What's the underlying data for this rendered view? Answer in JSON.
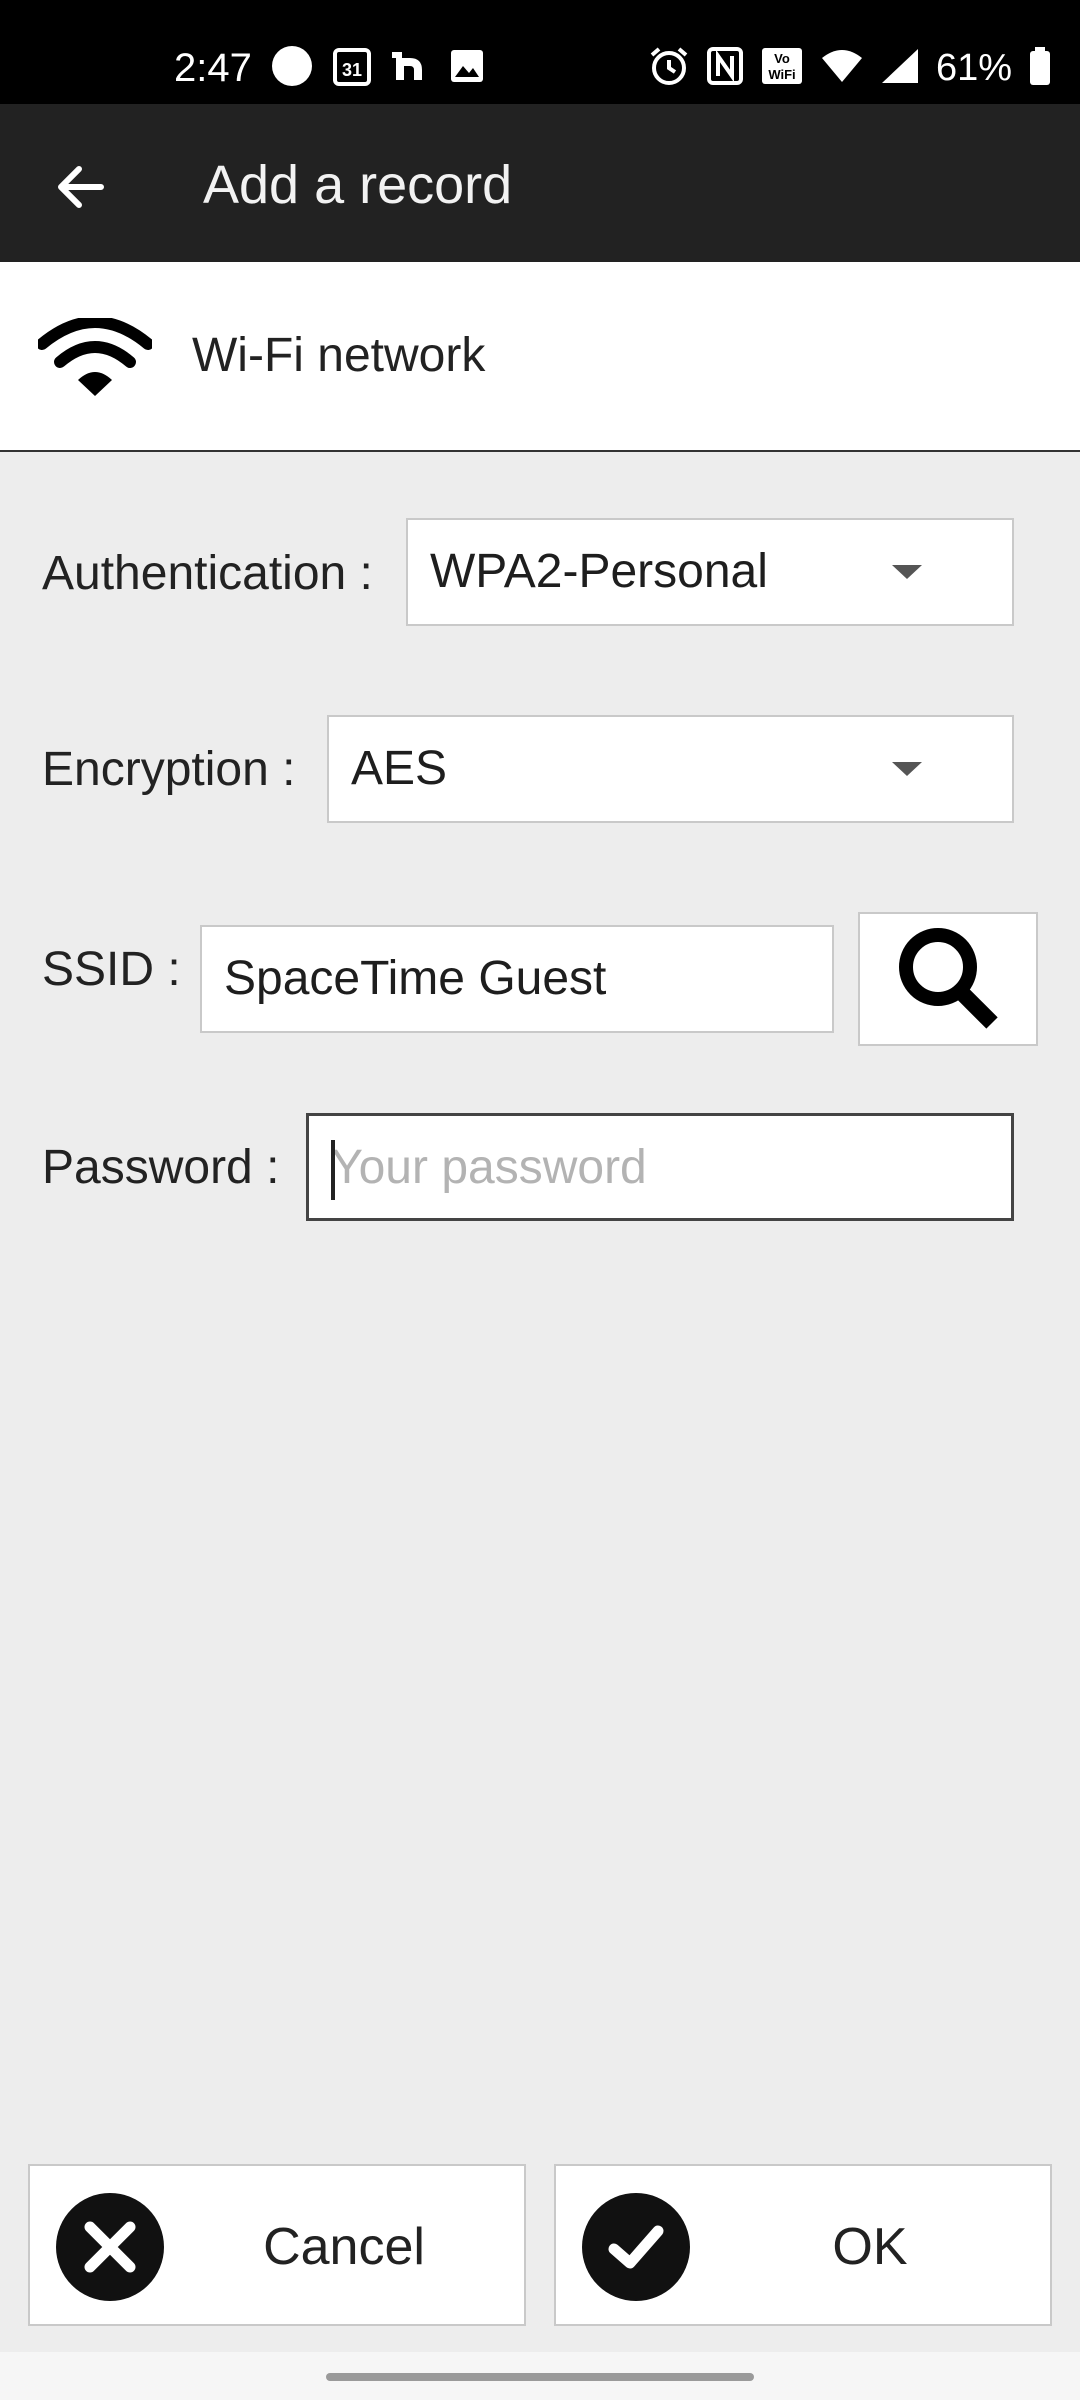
{
  "status_bar": {
    "time": "2:47",
    "battery": "61%",
    "icons_left": [
      "circle-icon",
      "calendar-icon",
      "app-icon",
      "image-icon"
    ],
    "icons_right": [
      "alarm-icon",
      "nfc-icon",
      "vowifi-icon",
      "wifi-icon",
      "signal-icon",
      "battery-icon"
    ]
  },
  "app_bar": {
    "title": "Add a record",
    "back_icon": "arrow-left-icon"
  },
  "record_type": {
    "icon": "wifi-icon",
    "label": "Wi-Fi network"
  },
  "form": {
    "authentication": {
      "label": "Authentication :",
      "value": "WPA2-Personal"
    },
    "encryption": {
      "label": "Encryption :",
      "value": "AES"
    },
    "ssid": {
      "label": "SSID :",
      "value": "SpaceTime Guest",
      "search_icon": "search-icon"
    },
    "password": {
      "label": "Password :",
      "value": "",
      "placeholder": "Your password"
    }
  },
  "buttons": {
    "cancel": {
      "label": "Cancel",
      "icon": "close-icon"
    },
    "ok": {
      "label": "OK",
      "icon": "check-icon"
    }
  },
  "colors": {
    "status_bar_bg": "#000000",
    "app_bar_bg": "#222222",
    "page_bg": "#ededed",
    "field_bg": "#ffffff"
  }
}
